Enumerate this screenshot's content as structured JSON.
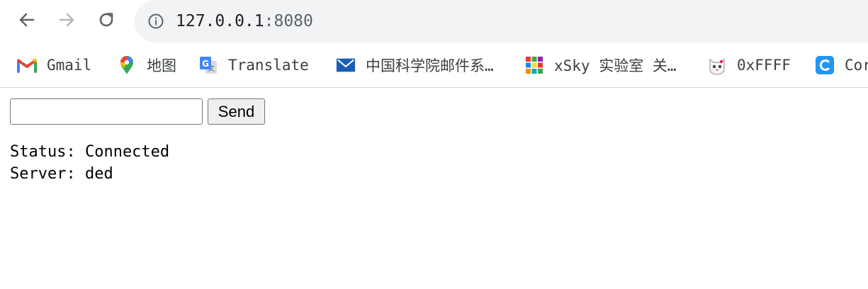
{
  "browser": {
    "url": {
      "host": "127.0.0.1",
      "port": ":8080"
    },
    "nav": {
      "back_icon": "arrow-left-icon",
      "forward_icon": "arrow-right-icon",
      "reload_icon": "reload-icon",
      "info_icon": "info-circle-icon"
    },
    "bookmarks": [
      {
        "label": "Gmail",
        "icon": "gmail-icon"
      },
      {
        "label": "地图",
        "icon": "maps-pin-icon"
      },
      {
        "label": "Translate",
        "icon": "translate-icon"
      },
      {
        "label": "中国科学院邮件系…",
        "icon": "mail-envelope-icon"
      },
      {
        "label": "xSky 实验室 关…",
        "icon": "xsky-grid-icon"
      },
      {
        "label": "0xFFFF",
        "icon": "cat-icon"
      },
      {
        "label": "Cor",
        "icon": "c-app-icon"
      }
    ]
  },
  "page": {
    "input": {
      "value": "",
      "placeholder": ""
    },
    "send_label": "Send",
    "status_line": "Status: Connected",
    "server_line": "Server: ded"
  },
  "colors": {
    "omnibox_bg": "#f1f3f4",
    "gmail_red": "#ea4335",
    "mail_blue": "#1a5fb4",
    "c_app_blue": "#2196f3"
  }
}
